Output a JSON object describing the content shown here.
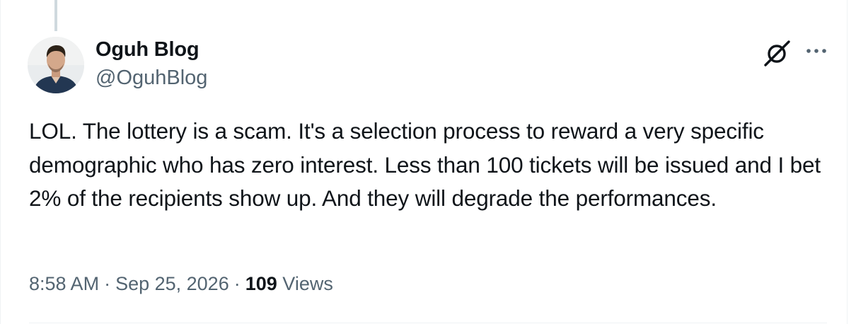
{
  "author": {
    "name": "Oguh Blog",
    "handle": "@OguhBlog"
  },
  "tweet": {
    "text": "LOL. The lottery is a scam. It's a selection process to reward a very specific demographic who has zero interest. Less than 100 tickets will be issued and I bet 2% of the recipients show up. And they will degrade the performances."
  },
  "meta": {
    "time": "8:58 AM",
    "separator": "·",
    "date": "Sep 25, 2026",
    "views_count": "109",
    "views_label": "Views"
  },
  "icons": {
    "grok": "grok-icon",
    "more": "more-icon"
  },
  "colors": {
    "text_primary": "#0f1419",
    "text_secondary": "#536471",
    "thread_line": "#cfd9de",
    "divider": "#eff3f4"
  }
}
